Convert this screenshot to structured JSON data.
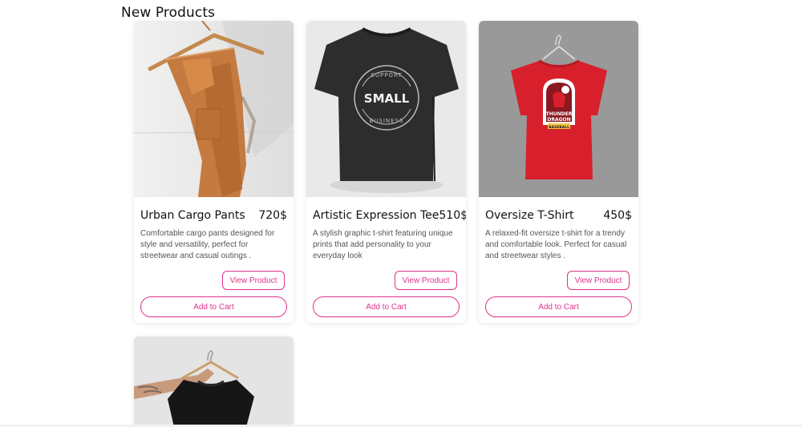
{
  "section": {
    "title": "New Products"
  },
  "products": [
    {
      "name": "Urban Cargo Pants",
      "price": "720$",
      "description": "Comfortable cargo pants designed for style and versatility, perfect for streetwear and casual outings .",
      "view_label": "View Product",
      "cart_label": "Add to Cart",
      "image_icon": "cargo-pants-photo"
    },
    {
      "name": "Artistic Expression Tee",
      "price": "510$",
      "description": "A stylish graphic t-shirt featuring unique prints that add personality to your everyday look",
      "view_label": "View Product",
      "cart_label": "Add to Cart",
      "image_icon": "black-tshirt-photo",
      "print": {
        "top": "SUPPORT",
        "middle": "SMALL",
        "bottom": "BUSINESS"
      }
    },
    {
      "name": "Oversize T-Shirt",
      "price": "450$",
      "description": "A relaxed-fit oversize t-shirt for a trendy and comfortable look. Perfect for casual and streetwear styles .",
      "view_label": "View Product",
      "cart_label": "Add to Cart",
      "image_icon": "red-tshirt-photo",
      "print": {
        "line1": "THUNDER",
        "line2": "DRAGON",
        "line3": "BASEBALL"
      }
    },
    {
      "image_icon": "black-tshirt-hanger-photo"
    }
  ],
  "colors": {
    "accent": "#e0338a",
    "text": "#111111",
    "muted": "#555555"
  }
}
